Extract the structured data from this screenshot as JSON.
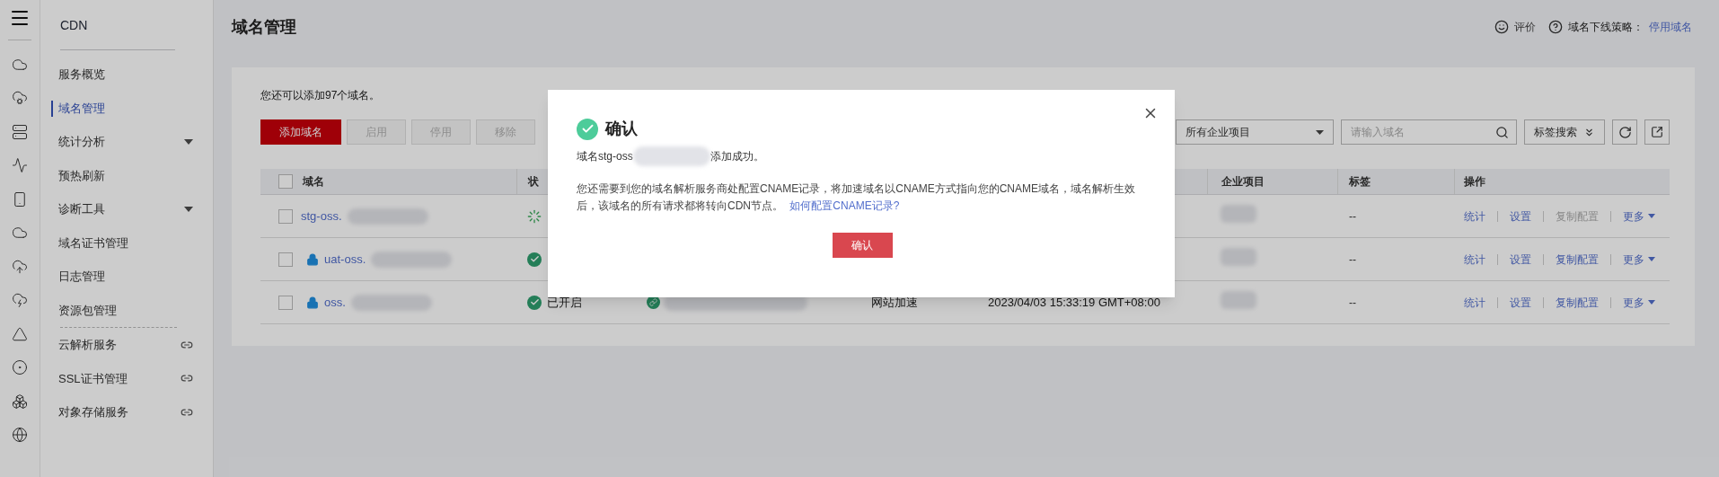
{
  "sidebar": {
    "title": "CDN",
    "items": [
      {
        "label": "服务概览",
        "kind": "plain",
        "selected": false
      },
      {
        "label": "域名管理",
        "kind": "plain",
        "selected": true
      },
      {
        "label": "统计分析",
        "kind": "expand",
        "selected": false
      },
      {
        "label": "预热刷新",
        "kind": "plain",
        "selected": false
      },
      {
        "label": "诊断工具",
        "kind": "expand",
        "selected": false
      },
      {
        "label": "域名证书管理",
        "kind": "plain",
        "selected": false
      },
      {
        "label": "日志管理",
        "kind": "plain",
        "selected": false
      },
      {
        "label": "资源包管理",
        "kind": "plain",
        "selected": false
      },
      {
        "label": "云解析服务",
        "kind": "external",
        "selected": false
      },
      {
        "label": "SSL证书管理",
        "kind": "external",
        "selected": false
      },
      {
        "label": "对象存储服务",
        "kind": "external",
        "selected": false
      }
    ]
  },
  "header": {
    "title": "域名管理",
    "rate": "评价",
    "policy_label": "域名下线策略：",
    "policy_link": "停用域名"
  },
  "card": {
    "quota": "您还可以添加97个域名。",
    "buttons": [
      {
        "label": "添加域名",
        "kind": "primary",
        "disabled": false
      },
      {
        "label": "启用",
        "kind": "default",
        "disabled": true
      },
      {
        "label": "停用",
        "kind": "default",
        "disabled": true
      },
      {
        "label": "移除",
        "kind": "default",
        "disabled": true
      }
    ],
    "project_select": "所有企业项目",
    "search": {
      "placeholder": "请输入域名"
    },
    "tag_search": "标签搜索"
  },
  "table": {
    "select_all": {
      "checked": false
    },
    "columns": {
      "domain": "域名",
      "status": "状",
      "project": "企业项目",
      "tags": "标签",
      "actions": "操作"
    },
    "rows": [
      {
        "checked": false,
        "locked": false,
        "domain": "stg-oss.",
        "kind": "pending",
        "tags": "--",
        "actions": [
          {
            "label": "统计",
            "kind": "link",
            "disabled": false
          },
          {
            "label": "设置",
            "kind": "link",
            "disabled": false
          },
          {
            "label": "复制配置",
            "kind": "link",
            "disabled": true
          },
          {
            "label": "更多",
            "kind": "menu",
            "disabled": false
          }
        ]
      },
      {
        "checked": false,
        "locked": true,
        "domain": "uat-oss.",
        "kind": "enabled",
        "tags": "--",
        "actions": [
          {
            "label": "统计",
            "kind": "link",
            "disabled": false
          },
          {
            "label": "设置",
            "kind": "link",
            "disabled": false
          },
          {
            "label": "复制配置",
            "kind": "link",
            "disabled": false
          },
          {
            "label": "更多",
            "kind": "menu",
            "disabled": false
          }
        ]
      },
      {
        "checked": false,
        "locked": true,
        "domain": "oss.",
        "kind": "enabled",
        "status": "已开启",
        "business_type": "网站加速",
        "created": "2023/04/03 15:33:19 GMT+08:00",
        "tags": "--",
        "actions": [
          {
            "label": "统计",
            "kind": "link",
            "disabled": false
          },
          {
            "label": "设置",
            "kind": "link",
            "disabled": false
          },
          {
            "label": "复制配置",
            "kind": "link",
            "disabled": false
          },
          {
            "label": "更多",
            "kind": "menu",
            "disabled": false
          }
        ]
      }
    ]
  },
  "modal": {
    "title": "确认",
    "message_prefix": "域名stg-oss",
    "message_suffix": "添加成功。",
    "note": "您还需要到您的域名解析服务商处配置CNAME记录，将加速域名以CNAME方式指向您的CNAME域名，域名解析生效后，该域名的所有请求都将转向CDN节点。",
    "note_link": "如何配置CNAME记录?",
    "confirm": "确认"
  }
}
